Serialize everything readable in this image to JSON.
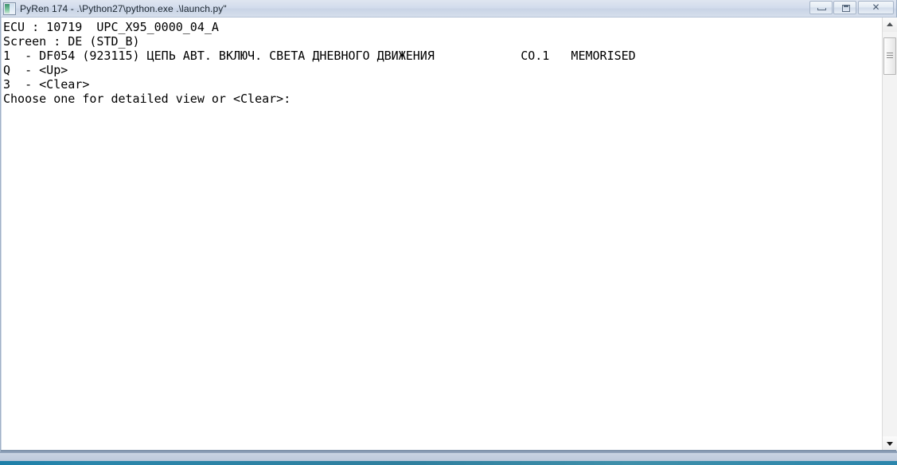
{
  "window": {
    "title": "PyRen 174 - .\\Python27\\python.exe  .\\launch.py\"",
    "icon": "python-console-icon",
    "controls": {
      "minimize": "Minimize",
      "maximize": "Maximize",
      "close": "Close",
      "close_glyph": "✕"
    }
  },
  "console": {
    "lines": [
      "ECU : 10719  UPC_X95_0000_04_A",
      "Screen : DE (STD_B)",
      "1  - DF054 (923115) ЦЕПЬ АВТ. ВКЛЮЧ. СВЕТА ДНЕВНОГО ДВИЖЕНИЯ            CO.1   MEMORISED",
      "Q  - <Up>",
      "3  - <Clear>",
      "Choose one for detailed view or <Clear>:"
    ],
    "text": "ECU : 10719  UPC_X95_0000_04_A\nScreen : DE (STD_B)\n1  - DF054 (923115) ЦЕПЬ АВТ. ВКЛЮЧ. СВЕТА ДНЕВНОГО ДВИЖЕНИЯ            CO.1   MEMORISED\nQ  - <Up>\n3  - <Clear>\nChoose one for detailed view or <Clear>:",
    "fields": {
      "ecu_label": "ECU :",
      "ecu_number": "10719",
      "ecu_name": "UPC_X95_0000_04_A",
      "screen_label": "Screen :",
      "screen_value": "DE (STD_B)",
      "dtc_index": "1",
      "dtc_code": "DF054",
      "dtc_number": "923115",
      "dtc_description": "ЦЕПЬ АВТ. ВКЛЮЧ. СВЕТА ДНЕВНОГО ДВИЖЕНИЯ",
      "dtc_context": "CO.1",
      "dtc_status": "MEMORISED",
      "option_up_key": "Q",
      "option_up_label": "<Up>",
      "option_clear_key": "3",
      "option_clear_label": "<Clear>",
      "prompt": "Choose one for detailed view or <Clear>:"
    },
    "colors": {
      "background": "#ffffff",
      "foreground": "#000000"
    }
  },
  "scrollbar": {
    "up_arrow": "scroll-up-arrow",
    "down_arrow": "scroll-down-arrow",
    "thumb": "scroll-thumb"
  },
  "taskbar": {
    "visible_sliver": true
  }
}
